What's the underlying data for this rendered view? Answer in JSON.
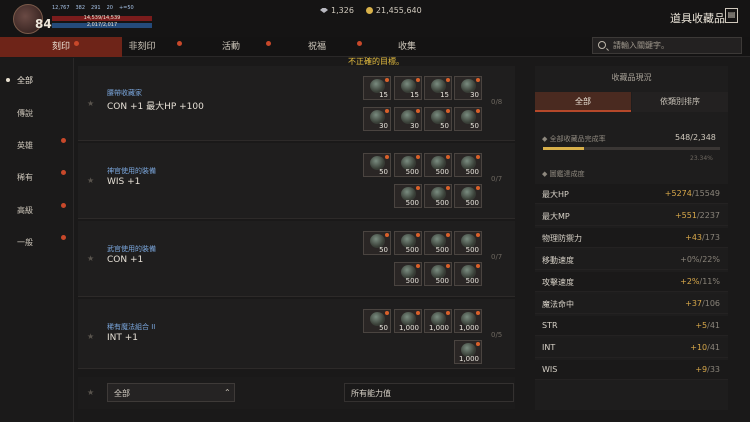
{
  "player": {
    "level": "84",
    "stats": [
      "12,767",
      "382",
      "291",
      "20",
      "+=50"
    ],
    "hp_text": "14,539/14,539",
    "mp_text": "2,017/2,017"
  },
  "currency": {
    "gems": "1,326",
    "gold": "21,455,640"
  },
  "title": "道具收藏品",
  "tabs": [
    {
      "label": "刻印",
      "alert": true
    },
    {
      "label": "非刻印",
      "alert": true
    },
    {
      "label": "活動",
      "alert": true
    },
    {
      "label": "祝福",
      "alert": true
    },
    {
      "label": "收集",
      "alert": false
    }
  ],
  "search": {
    "placeholder": "請輸入關鍵字。"
  },
  "sidebar": [
    {
      "label": "全部",
      "active": true,
      "alert": false
    },
    {
      "label": "傳說",
      "active": false,
      "alert": false
    },
    {
      "label": "英雄",
      "active": false,
      "alert": true
    },
    {
      "label": "稀有",
      "active": false,
      "alert": true
    },
    {
      "label": "高級",
      "active": false,
      "alert": true
    },
    {
      "label": "一般",
      "active": false,
      "alert": true
    }
  ],
  "warning": "不正確的目標。",
  "collections": [
    {
      "title": "腰帶收藏家",
      "effect": "CON +1 最大HP +100",
      "count": "0/8",
      "slots": [
        "15",
        "15",
        "15",
        "30",
        "30",
        "30",
        "50",
        "50"
      ]
    },
    {
      "title": "神官使用的裝備",
      "effect": "WIS +1",
      "count": "0/7",
      "slots": [
        "50",
        "500",
        "500",
        "500",
        "500",
        "500",
        "500"
      ]
    },
    {
      "title": "武官使用的裝備",
      "effect": "CON +1",
      "count": "0/7",
      "slots": [
        "50",
        "500",
        "500",
        "500",
        "500",
        "500",
        "500"
      ]
    },
    {
      "title": "稀有魔法組合 II",
      "effect": "INT +1",
      "count": "0/5",
      "slots": [
        "50",
        "1,000",
        "1,000",
        "1,000",
        "1,000"
      ]
    }
  ],
  "bottom": {
    "filter": "全部",
    "stat_filter": "所有能力值"
  },
  "panel": {
    "title": "收藏品現況",
    "tab_all": "全部",
    "tab_speed": "依類別排序",
    "completion_label": "全部收藏品完成率",
    "completion_count": "548/2,348",
    "completion_pct": "23.34%",
    "completion_fraction": 0.2334,
    "section_label": "圖鑑達成度",
    "stats": [
      {
        "name": "最大HP",
        "current": "+5274",
        "max": "/15549"
      },
      {
        "name": "最大MP",
        "current": "+551",
        "max": "/2237"
      },
      {
        "name": "物理防禦力",
        "current": "+43",
        "max": "/173"
      },
      {
        "name": "移動速度",
        "current": "+0%",
        "max": "/22%"
      },
      {
        "name": "攻擊速度",
        "current": "+2%",
        "max": "/11%"
      },
      {
        "name": "魔法命中",
        "current": "+37",
        "max": "/106"
      },
      {
        "name": "STR",
        "current": "+5",
        "max": "/41"
      },
      {
        "name": "INT",
        "current": "+10",
        "max": "/41"
      },
      {
        "name": "WIS",
        "current": "+9",
        "max": "/33"
      }
    ]
  },
  "colors": {
    "accent": "#6e2418",
    "alert": "#c8482a",
    "gold": "#d8b04a",
    "link": "#7aa6dc"
  }
}
